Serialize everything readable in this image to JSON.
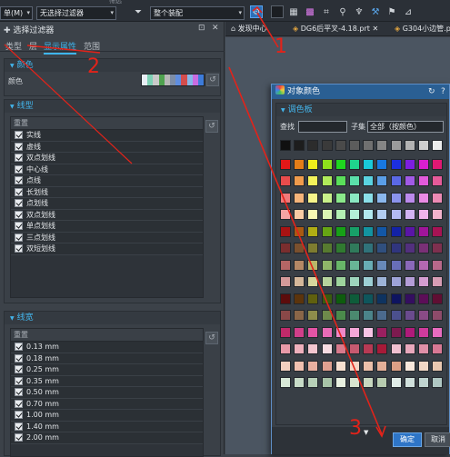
{
  "toolbar": {
    "menu_label": "单(M)",
    "filter_select": "无选择过滤器",
    "assembly_select": "整个装配",
    "section_caption": "筛选"
  },
  "left_panel": {
    "title": "选择过滤器",
    "tabs": [
      "类型",
      "层",
      "显示属性",
      "范围"
    ],
    "active_tab": "显示属性",
    "color_section": {
      "header": "颜色",
      "color_label": "颜色",
      "swatches": [
        "#e8eef5",
        "#7ed1b5",
        "#c9c9c9",
        "#4fa24f",
        "#b7b7b7",
        "#7e8ea7",
        "#5f8ee0",
        "#d34d4d",
        "#86b7e8",
        "#c86ce0",
        "#3d7bd9"
      ]
    },
    "linetype_section": {
      "header": "线型",
      "list_header": "重置",
      "items": [
        "实线",
        "虚线",
        "双点划线",
        "中心线",
        "点线",
        "长划线",
        "点划线",
        "双点划线",
        "单点划线",
        "三点划线",
        "双短划线"
      ]
    },
    "linewidth_section": {
      "header": "线宽",
      "list_header": "重置",
      "items": [
        "0.13 mm",
        "0.18 mm",
        "0.25 mm",
        "0.35 mm",
        "0.50 mm",
        "0.70 mm",
        "1.00 mm",
        "1.40 mm",
        "2.00 mm"
      ]
    }
  },
  "doc_tabs": [
    "发现中心",
    "DG6后平叉-4.18.prt",
    "G304小边管.p"
  ],
  "dialog": {
    "title": "对象颜色",
    "palette_header": "调色板",
    "search_label": "查找",
    "subset_label": "子集",
    "subset_value": "全部（按颜色）",
    "ok_label": "确定",
    "cancel_label": "取消"
  },
  "annotations": [
    "1",
    "2",
    "3"
  ],
  "palette": {
    "top_row": [
      "#101010",
      "#1d1d1d",
      "#2c2c2c",
      "#3a3a3a",
      "#4a4a4a",
      "#5c5c5c",
      "#707070",
      "#858585",
      "#9b9b9b",
      "#b3b3b3",
      "#cfcfcf",
      "#ececec"
    ],
    "rows": [
      [
        "#e31818",
        "#e37d18",
        "#f0ec1b",
        "#8ee11c",
        "#1fd61f",
        "#1fd68d",
        "#19c9d9",
        "#1878e0",
        "#1c2fe0",
        "#7d1fe0",
        "#d91fd0",
        "#e01873"
      ],
      [
        "#e84c4c",
        "#f09b4c",
        "#f4f25a",
        "#b0ea5a",
        "#5adf5a",
        "#5ae0aa",
        "#5ad3e0",
        "#5a9ee6",
        "#5a68e6",
        "#a15ae6",
        "#e35adc",
        "#e65a99"
      ],
      [
        "#ef7a7a",
        "#f5b47a",
        "#f7f58a",
        "#c8f08a",
        "#8ae88a",
        "#8ae8c2",
        "#8adfe8",
        "#8ab7ec",
        "#8a93ec",
        "#bb8aec",
        "#ea8ae4",
        "#ec8ab4"
      ],
      [
        "#f4a4a4",
        "#f8cba4",
        "#f9f8b3",
        "#dbf4b3",
        "#b3efb3",
        "#b3efd6",
        "#b3e9ef",
        "#b3cef2",
        "#b3b9f2",
        "#d2b3f2",
        "#f0b3ec",
        "#f2b3cc"
      ],
      [
        "#a81313",
        "#a85a13",
        "#b0ad14",
        "#66a514",
        "#17a017",
        "#17a068",
        "#1393a0",
        "#1357a6",
        "#1322a6",
        "#5a15a6",
        "#a0159a",
        "#a61354"
      ],
      [
        "#7a2e2e",
        "#7a502e",
        "#7e7c30",
        "#577a30",
        "#307a30",
        "#307a5b",
        "#30727a",
        "#304f7e",
        "#30357e",
        "#52307e",
        "#7a3076",
        "#7e304f"
      ],
      [
        "#b56565",
        "#b58865",
        "#b9b768",
        "#8fb568",
        "#68b568",
        "#68b596",
        "#68adb5",
        "#6889b9",
        "#686eb9",
        "#8a68b9",
        "#b568b1",
        "#b9688a"
      ],
      [
        "#d49a9a",
        "#d4b79a",
        "#d7d69d",
        "#b7d49d",
        "#9dd49d",
        "#9dd4bc",
        "#9dcfd4",
        "#9db3d7",
        "#9da2d7",
        "#b49dd7",
        "#d49dd1",
        "#d79db4"
      ],
      [
        "#5c0c0c",
        "#5c340c",
        "#60600e",
        "#3a5c0e",
        "#0e5c0e",
        "#0e5c3a",
        "#0e565c",
        "#0e3360",
        "#0e1460",
        "#340e60",
        "#5c0e58",
        "#600e33"
      ],
      [
        "#8a4848",
        "#8a6648",
        "#8e8c4b",
        "#6e8a4b",
        "#4b8a4b",
        "#4b8a6f",
        "#4b848a",
        "#4b6a8e",
        "#4b508e",
        "#6a4b8e",
        "#8a4b86",
        "#8e4b6a"
      ],
      [
        "#c02a6a",
        "#d03f8a",
        "#e354a5",
        "#e86cb7",
        "#ee88c8",
        "#f3a7d8",
        "#f7c5e6",
        "#9a2060",
        "#7d1a4f",
        "#b01a7a",
        "#d03b9d",
        "#e86cc0"
      ],
      [
        "#e89aa8",
        "#eeb0bc",
        "#f3c6cf",
        "#f7dbe1",
        "#d77a8c",
        "#c75a70",
        "#b73a54",
        "#a71a38",
        "#f0c0d0",
        "#e8a8bc",
        "#e090a8",
        "#d87894"
      ],
      [
        "#f3d0c0",
        "#f0c0b0",
        "#e8b0a0",
        "#e0a090",
        "#f7e0d0",
        "#f5d5c5",
        "#ecc0aa",
        "#e4b098",
        "#dca086",
        "#f8e8dc",
        "#f2d8c6",
        "#eac8b0"
      ],
      [
        "#d8e8d8",
        "#c8dcc8",
        "#b8d0b8",
        "#a8c4a8",
        "#e8f0e0",
        "#d8e4d0",
        "#c8d8c0",
        "#b8ccb0",
        "#e0ece8",
        "#d0e0dc",
        "#c0d4d0",
        "#b0c8c4"
      ]
    ]
  }
}
